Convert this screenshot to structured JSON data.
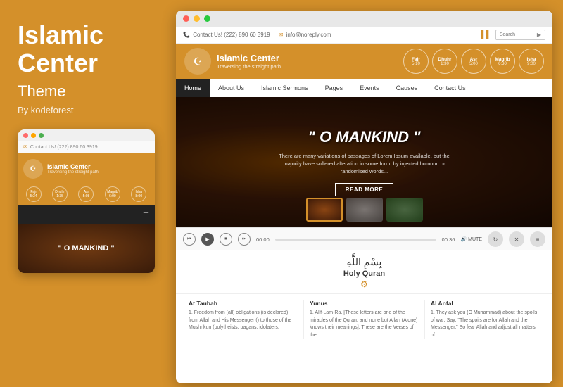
{
  "left": {
    "title": "Islamic\nCenter",
    "subtitle": "Theme",
    "by": "By kodeforest"
  },
  "mobile": {
    "contact": "Contact Us! (222) 890 60 3919",
    "site_name": "Islamic Center",
    "site_tagline": "Traversing the straight path",
    "prayer_times": [
      {
        "name": "Fajr",
        "time": "5:34"
      },
      {
        "name": "Dhuhr",
        "time": "1:35"
      },
      {
        "name": "Asr",
        "time": "5:08"
      },
      {
        "name": "Magrib",
        "time": "6:00"
      },
      {
        "name": "Isha",
        "time": "8:00"
      }
    ],
    "hero_text": "\" O MANKIND \""
  },
  "browser": {
    "contact_phone": "Contact Us! (222) 890 60 3919",
    "contact_email": "info@noreply.com",
    "search_placeholder": "Search",
    "site_name": "Islamic Center",
    "site_tagline": "Traversing the straight path",
    "prayer_times": [
      {
        "name": "Fajr",
        "time": "5:10"
      },
      {
        "name": "Dhuhr",
        "time": "1:30"
      },
      {
        "name": "Asr",
        "time": "5:00"
      },
      {
        "name": "Magrib",
        "time": "6:30"
      },
      {
        "name": "Isha",
        "time": "9:00"
      }
    ],
    "nav": [
      "Home",
      "About Us",
      "Islamic Sermons",
      "Pages",
      "Events",
      "Causes",
      "Contact Us"
    ],
    "hero_quote": "\" O MANKIND \"",
    "hero_desc": "There are many variations of passages of Lorem Ipsum available, but the majority have suffered alteration in some form, by injected humour, or randomised words...",
    "hero_btn": "READ MORE",
    "player_time_start": "00:00",
    "player_time_end": "00:36",
    "mute_label": "MUTE",
    "quran_arabic": "بِسْمِ اللَّهِ",
    "quran_title": "Holy Quran",
    "articles": [
      {
        "title": "At Taubah",
        "text": "1. Freedom from (all) obligations (is declared) from Allah and His Messenger () to those of the Mushrikun (polytheists, pagans, idolaters,"
      },
      {
        "title": "Yunus",
        "text": "1. Alif-Lam-Ra. [These letters are one of the miracles of the Quran, and none but Allah (Alone) knows their meanings]. These are the Verses of the"
      },
      {
        "title": "Al Anfal",
        "text": "1. They ask you (O Muhammad) about the spoils of war. Say: \"The spoils are for Allah and the Messenger.\" So fear Allah and adjust all matters of"
      }
    ]
  }
}
